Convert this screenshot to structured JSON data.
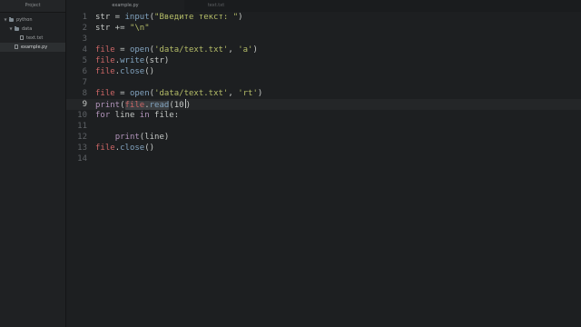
{
  "sidebar": {
    "title": "Project",
    "tree": [
      {
        "label": "python",
        "type": "folder"
      },
      {
        "label": "data",
        "type": "folder"
      },
      {
        "label": "text.txt",
        "type": "file"
      },
      {
        "label": "example.py",
        "type": "file"
      }
    ]
  },
  "tabs": [
    {
      "label": "example.py",
      "active": true
    },
    {
      "label": "text.txt",
      "active": false
    }
  ],
  "editor": {
    "line_numbers": [
      "1",
      "2",
      "3",
      "4",
      "5",
      "6",
      "7",
      "8",
      "9",
      "10",
      "11",
      "12",
      "13",
      "14"
    ],
    "current_line": "9",
    "lines": {
      "l1": {
        "a": "str = ",
        "b": "input",
        "c": "(",
        "d": "\"Введите текст: \"",
        "e": ")"
      },
      "l2": {
        "a": "str += ",
        "b": "\"\\n\""
      },
      "l4": {
        "a": "file",
        "b": " = ",
        "c": "open",
        "d": "(",
        "e": "'data/text.txt'",
        "f": ", ",
        "g": "'a'",
        "h": ")"
      },
      "l5": {
        "a": "file",
        "b": ".",
        "c": "write",
        "d": "(str)"
      },
      "l6": {
        "a": "file",
        "b": ".",
        "c": "close",
        "d": "()"
      },
      "l8": {
        "a": "file",
        "b": " = ",
        "c": "open",
        "d": "(",
        "e": "'data/text.txt'",
        "f": ", ",
        "g": "'rt'",
        "h": ")"
      },
      "l9": {
        "a": "print",
        "b": "(",
        "c": "file",
        "d": ".",
        "e": "read",
        "f": "(10",
        "g": ")"
      },
      "l10": {
        "a": "for",
        "b": " line ",
        "c": "in",
        "d": " file:"
      },
      "l12": {
        "a": "    ",
        "b": "print",
        "c": "(line)"
      },
      "l13": {
        "a": "file",
        "b": ".",
        "c": "close",
        "d": "()"
      }
    }
  }
}
